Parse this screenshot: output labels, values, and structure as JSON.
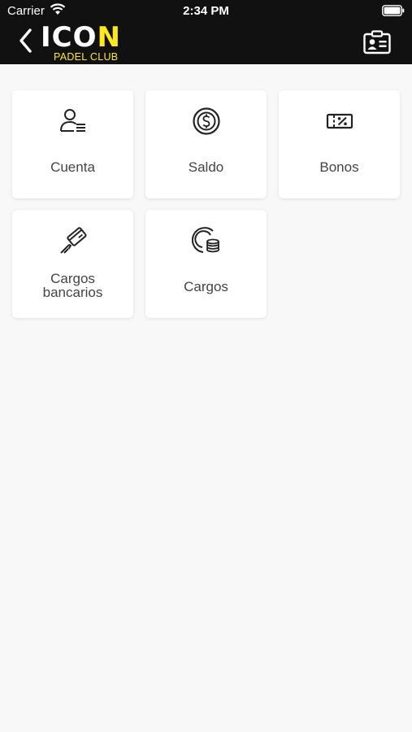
{
  "status_bar": {
    "carrier": "Carrier",
    "time": "2:34 PM"
  },
  "header": {
    "logo_text": "ICON",
    "logo_subtitle": "PADEL CLUB",
    "accent_color": "#ffe81c",
    "background_color": "#111111",
    "back_icon": "chevron-left-icon",
    "right_icon": "id-card-icon"
  },
  "tiles": [
    {
      "label": "Cuenta",
      "icon": "user-list-icon"
    },
    {
      "label": "Saldo",
      "icon": "dollar-coin-icon"
    },
    {
      "label": "Bonos",
      "icon": "discount-ticket-icon"
    },
    {
      "label_line1": "Cargos",
      "label_line2": "bancarios",
      "icon": "credit-card-hand-icon"
    },
    {
      "label": "Cargos",
      "icon": "coins-stack-icon"
    }
  ]
}
